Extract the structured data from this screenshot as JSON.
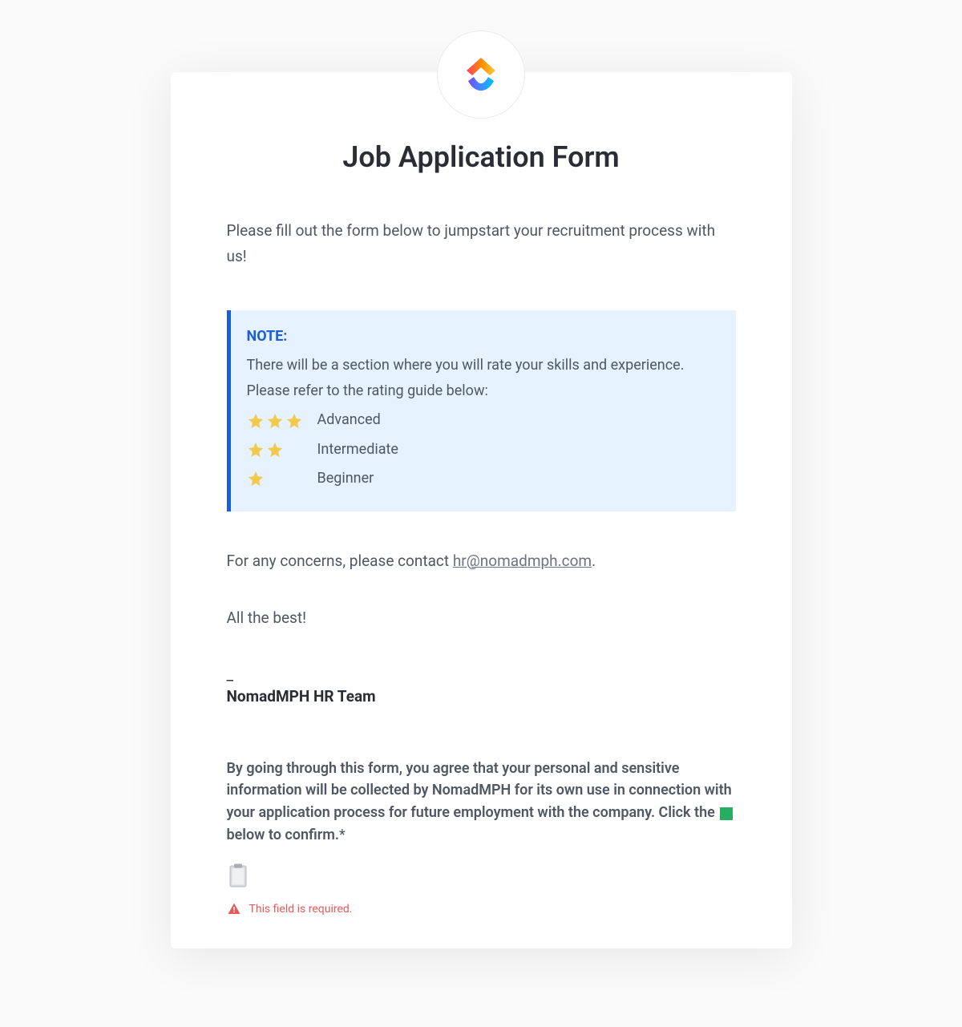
{
  "form": {
    "title": "Job Application Form",
    "intro": "Please fill out the form below to jumpstart your recruitment process with us!",
    "note": {
      "label": "NOTE:",
      "body": "There will be a section where you will rate your skills and experience. Please refer to the rating guide below:",
      "ratings": [
        {
          "stars": 3,
          "label": "Advanced"
        },
        {
          "stars": 2,
          "label": "Intermediate"
        },
        {
          "stars": 1,
          "label": "Beginner"
        }
      ]
    },
    "contact": {
      "prefix": "For any concerns, please contact ",
      "email": "hr@nomadmph.com",
      "suffix": "."
    },
    "sign_off": "All the best!",
    "dash": "_",
    "team": "NomadMPH HR Team",
    "consent": {
      "text_before_box": "By going through this form, you agree that your personal and sensitive information will be collected by NomadMPH for its own use in connec­tion with your application process for future employment with the com­pany. Click the ",
      "text_after_box": " below to confirm.",
      "asterisk": "*"
    },
    "error": "This field is required."
  }
}
